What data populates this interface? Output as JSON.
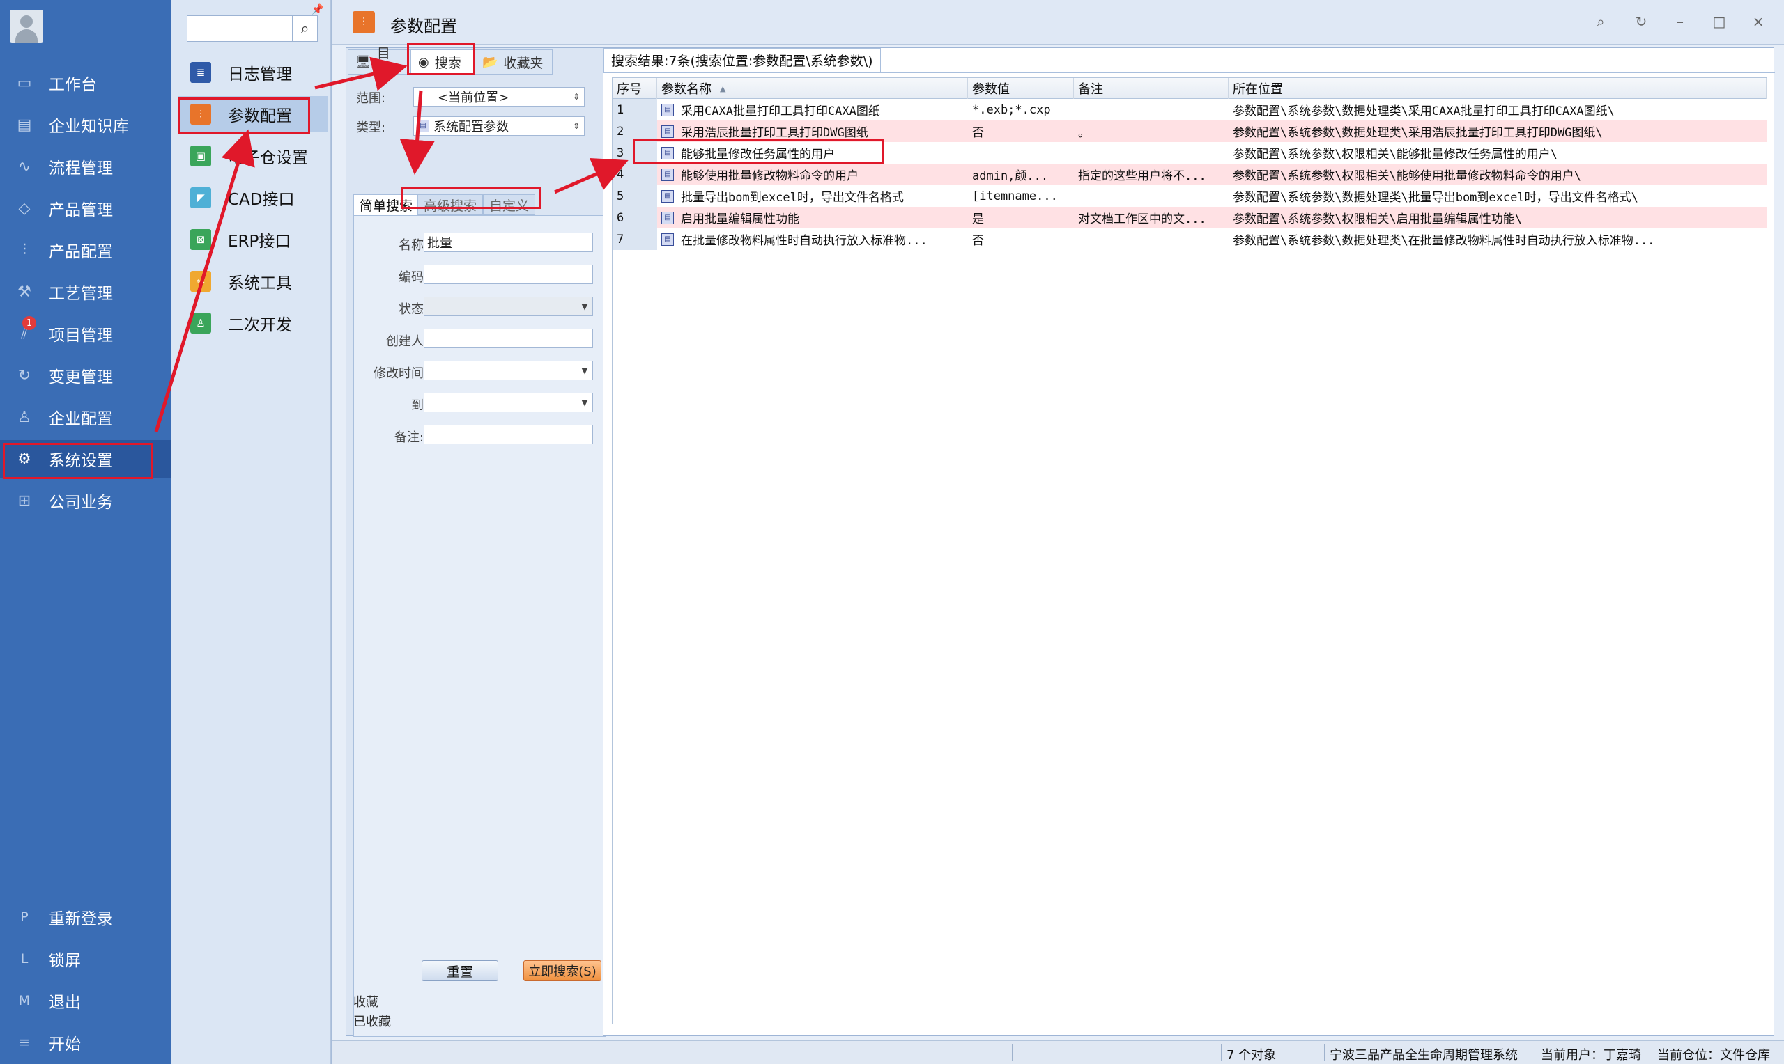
{
  "leftnav": {
    "items": [
      {
        "label": "工作台",
        "icon": "monitor-icon"
      },
      {
        "label": "企业知识库",
        "icon": "book-icon"
      },
      {
        "label": "流程管理",
        "icon": "flow-icon"
      },
      {
        "label": "产品管理",
        "icon": "cube-icon"
      },
      {
        "label": "产品配置",
        "icon": "sliders-icon"
      },
      {
        "label": "工艺管理",
        "icon": "wrench-icon"
      },
      {
        "label": "项目管理",
        "icon": "chart-icon"
      },
      {
        "label": "变更管理",
        "icon": "change-icon"
      },
      {
        "label": "企业配置",
        "icon": "org-icon"
      },
      {
        "label": "系统设置",
        "icon": "gear-icon"
      },
      {
        "label": "公司业务",
        "icon": "grid-icon"
      }
    ],
    "badge": "1",
    "bottom": [
      {
        "key": "P",
        "label": "重新登录"
      },
      {
        "key": "L",
        "label": "锁屏"
      },
      {
        "key": "M",
        "label": "退出"
      },
      {
        "key": "≡",
        "label": "开始"
      }
    ]
  },
  "submenu": {
    "items": [
      {
        "label": "日志管理",
        "color": "#2f5aa8"
      },
      {
        "label": "参数配置",
        "color": "#e8742a"
      },
      {
        "label": "电子仓设置",
        "color": "#3aa55a"
      },
      {
        "label": "CAD接口",
        "color": "#4fb0d6"
      },
      {
        "label": "ERP接口",
        "color": "#3aa55a"
      },
      {
        "label": "系统工具",
        "color": "#f0a830"
      },
      {
        "label": "二次开发",
        "color": "#3aa55a"
      }
    ]
  },
  "window": {
    "title": "参数配置"
  },
  "leftpane": {
    "tabs": [
      "目录",
      "搜索",
      "收藏夹"
    ],
    "scope_label": "范围:",
    "scope_value": "<当前位置>",
    "type_label": "类型:",
    "type_value": "系统配置参数",
    "subtabs": [
      "简单搜索",
      "高级搜索",
      "自定义"
    ],
    "fields": [
      {
        "label": "名称",
        "value": "批量"
      },
      {
        "label": "编码",
        "value": ""
      },
      {
        "label": "状态",
        "value": ""
      },
      {
        "label": "创建人",
        "value": ""
      },
      {
        "label": "修改时间",
        "value": ""
      },
      {
        "label": "到",
        "value": ""
      },
      {
        "label": "备注:",
        "value": ""
      }
    ],
    "reset": "重置",
    "search_now": "立即搜索(S)",
    "fav_label": "收藏",
    "fav_value": "已收藏"
  },
  "results": {
    "tab": "搜索结果:7条(搜索位置:参数配置\\系统参数\\)",
    "columns": [
      "序号",
      "参数名称",
      "参数值",
      "备注",
      "所在位置"
    ],
    "rows": [
      {
        "no": "1",
        "name": "采用CAXA批量打印工具打印CAXA图纸",
        "value": "*.exb;*.cxp",
        "note": "",
        "path": "参数配置\\系统参数\\数据处理类\\采用CAXA批量打印工具打印CAXA图纸\\"
      },
      {
        "no": "2",
        "name": "采用浩辰批量打印工具打印DWG图纸",
        "value": "否",
        "note": "。",
        "path": "参数配置\\系统参数\\数据处理类\\采用浩辰批量打印工具打印DWG图纸\\"
      },
      {
        "no": "3",
        "name": "能够批量修改任务属性的用户",
        "value": "",
        "note": "",
        "path": "参数配置\\系统参数\\权限相关\\能够批量修改任务属性的用户\\"
      },
      {
        "no": "4",
        "name": "能够使用批量修改物料命令的用户",
        "value": "admin,颜...",
        "note": "指定的这些用户将不...",
        "path": "参数配置\\系统参数\\权限相关\\能够使用批量修改物料命令的用户\\"
      },
      {
        "no": "5",
        "name": "批量导出bom到excel时，导出文件名格式",
        "value": "[itemname...",
        "note": "",
        "path": "参数配置\\系统参数\\数据处理类\\批量导出bom到excel时，导出文件名格式\\"
      },
      {
        "no": "6",
        "name": "启用批量编辑属性功能",
        "value": "是",
        "note": "对文档工作区中的文...",
        "path": "参数配置\\系统参数\\权限相关\\启用批量编辑属性功能\\"
      },
      {
        "no": "7",
        "name": "在批量修改物料属性时自动执行放入标准物...",
        "value": "否",
        "note": "",
        "path": "参数配置\\系统参数\\数据处理类\\在批量修改物料属性时自动执行放入标准物..."
      }
    ]
  },
  "statusbar": {
    "count": "7 个对象",
    "system": "宁波三品产品全生命周期管理系统",
    "user": "当前用户：丁嘉琦",
    "location": "当前仓位：文件仓库"
  },
  "colors": {
    "nav_bg": "#3a6db5",
    "highlight_row": "#ffe1e4",
    "annotation_red": "#e0182a"
  }
}
